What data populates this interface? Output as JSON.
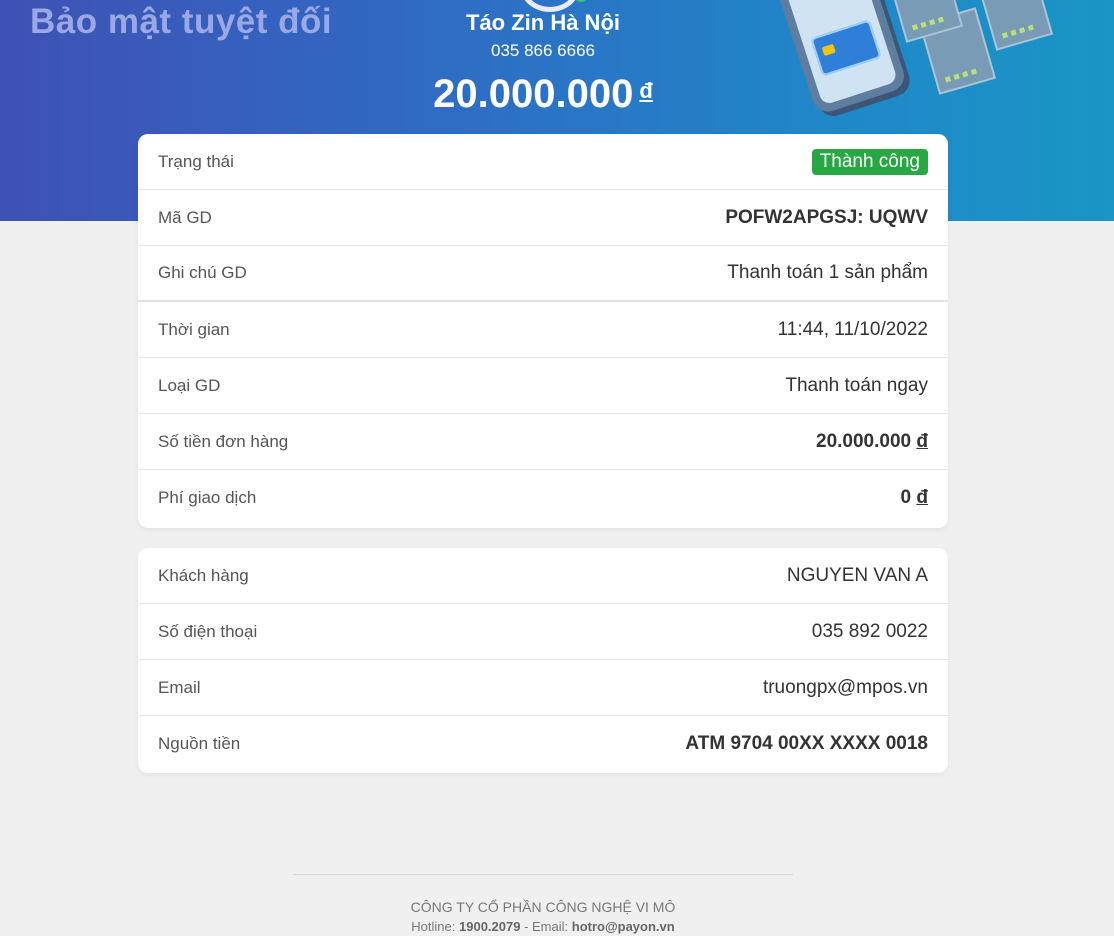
{
  "hero": {
    "slogan": "Bảo mật tuyệt đối",
    "merchant_name": "Táo Zin Hà Nội",
    "merchant_phone": "035 866 6666",
    "amount": "20.000.000",
    "currency": "đ",
    "gradient_start": "#3f51b5",
    "gradient_end": "#1a95c6"
  },
  "transaction": {
    "rows": [
      {
        "label": "Trạng thái",
        "value": "Thành công"
      },
      {
        "label": "Mã GD",
        "value": "POFW2APGSJ: UQWV"
      },
      {
        "label": "Ghi chú GD",
        "value": "Thanh toán 1 sản phẩm"
      },
      {
        "label": "Thời gian",
        "value": "11:44, 11/10/2022"
      },
      {
        "label": "Loại GD",
        "value": "Thanh toán ngay"
      },
      {
        "label": "Số tiền đơn hàng",
        "value": "20.000.000",
        "currency": "đ"
      },
      {
        "label": "Phí giao dịch",
        "value": "0",
        "currency": "đ"
      }
    ],
    "status_color": "#28a745"
  },
  "customer": {
    "rows": [
      {
        "label": "Khách hàng",
        "value": "NGUYEN VAN A"
      },
      {
        "label": "Số điện thoại",
        "value": "035 892 0022"
      },
      {
        "label": "Email",
        "value": "truongpx@mpos.vn"
      },
      {
        "label": "Nguồn tiền",
        "value": "ATM 9704 00XX XXXX 0018"
      }
    ]
  },
  "footer": {
    "company": "CÔNG TY CỔ PHẦN CÔNG NGHỆ VI MÔ",
    "hotline_label": "Hotline:",
    "hotline": "1900.2079",
    "separator": " - Email: ",
    "email": "hotro@payon.vn"
  }
}
